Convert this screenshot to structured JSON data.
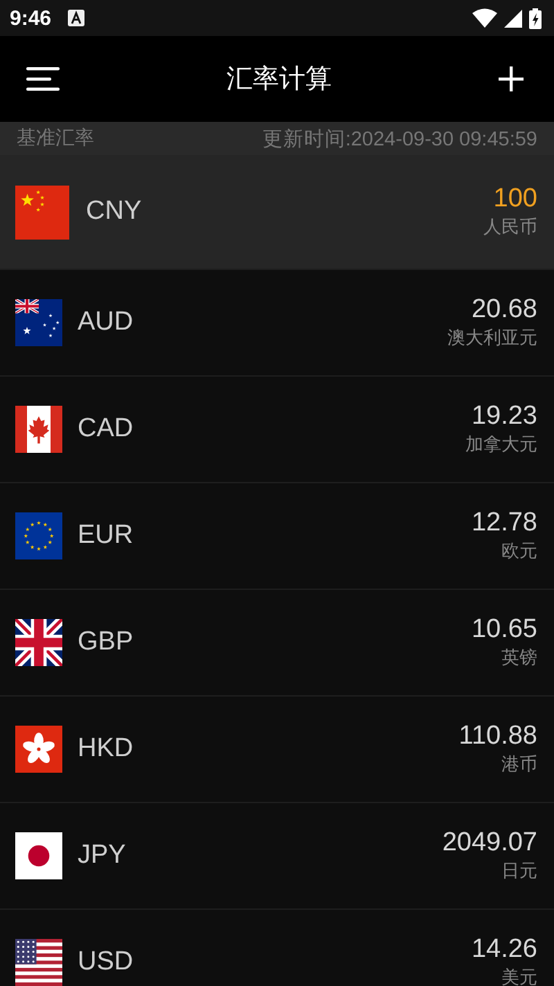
{
  "status_bar": {
    "time": "9:46"
  },
  "app_bar": {
    "title": "汇率计算"
  },
  "subheader": {
    "label": "基准汇率",
    "updated": "更新时间:2024-09-30 09:45:59"
  },
  "currencies": [
    {
      "code": "CNY",
      "amount": "100",
      "name": "人民币",
      "selected": true
    },
    {
      "code": "AUD",
      "amount": "20.68",
      "name": "澳大利亚元",
      "selected": false
    },
    {
      "code": "CAD",
      "amount": "19.23",
      "name": "加拿大元",
      "selected": false
    },
    {
      "code": "EUR",
      "amount": "12.78",
      "name": "欧元",
      "selected": false
    },
    {
      "code": "GBP",
      "amount": "10.65",
      "name": "英镑",
      "selected": false
    },
    {
      "code": "HKD",
      "amount": "110.88",
      "name": "港币",
      "selected": false
    },
    {
      "code": "JPY",
      "amount": "2049.07",
      "name": "日元",
      "selected": false
    },
    {
      "code": "USD",
      "amount": "14.26",
      "name": "美元",
      "selected": false
    }
  ]
}
